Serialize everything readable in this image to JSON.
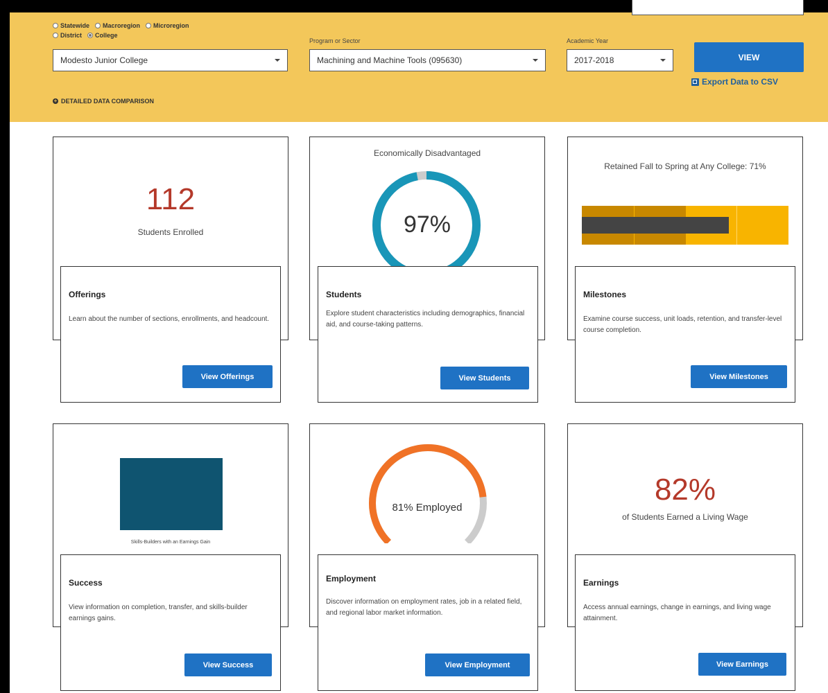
{
  "filters": {
    "radios": [
      {
        "label": "Statewide",
        "checked": false
      },
      {
        "label": "Macroregion",
        "checked": false
      },
      {
        "label": "Microregion",
        "checked": false
      },
      {
        "label": "District",
        "checked": false
      },
      {
        "label": "College",
        "checked": true
      }
    ],
    "college_select": "Modesto Junior College",
    "program_label": "Program or Sector",
    "program_select": "Machining and Machine Tools (095630)",
    "year_label": "Academic Year",
    "year_select": "2017-2018",
    "view_button": "VIEW",
    "export_link": "Export Data to CSV",
    "detailed_toggle": "DETAILED DATA COMPARISON"
  },
  "colors": {
    "banner": "#f3c75a",
    "button": "#1f72c4",
    "accent_red": "#b4392a",
    "donut_blue": "#1996b8",
    "arc_orange": "#f07226",
    "bar_dark_gold": "#c88800",
    "bar_gold": "#f8b400",
    "bar_marker": "#444444",
    "success_bar": "#0f5470"
  },
  "cards": {
    "offerings": {
      "stat_value": "112",
      "stat_label": "Students Enrolled",
      "title": "Offerings",
      "description": "Learn about the number of sections, enrollments, and headcount.",
      "button": "View Offerings"
    },
    "students": {
      "chart_title": "Economically Disadvantaged",
      "percent_text": "97%",
      "percent_value": 97,
      "title": "Students",
      "description": "Explore student characteristics including demographics, financial aid, and course-taking patterns.",
      "button": "View Students"
    },
    "milestones": {
      "chart_title": "Retained Fall to Spring at Any College: 71%",
      "value": 71,
      "title": "Milestones",
      "description": "Examine course success, unit loads, retention, and transfer-level course completion.",
      "button": "View Milestones"
    },
    "success": {
      "chart_caption": "Skills-Builders with an Earnings Gain",
      "title": "Success",
      "description": "View information on completion, transfer, and skills-builder earnings gains.",
      "button": "View Success"
    },
    "employment": {
      "gauge_text": "81% Employed",
      "percent_value": 81,
      "title": "Employment",
      "description": "Discover information on employment rates, job in a related field, and regional labor market information.",
      "button": "View Employment"
    },
    "earnings": {
      "stat_value": "82%",
      "stat_label": "of Students Earned a Living Wage",
      "title": "Earnings",
      "description": "Access annual earnings, change in earnings, and living wage attainment.",
      "button": "View Earnings"
    }
  }
}
